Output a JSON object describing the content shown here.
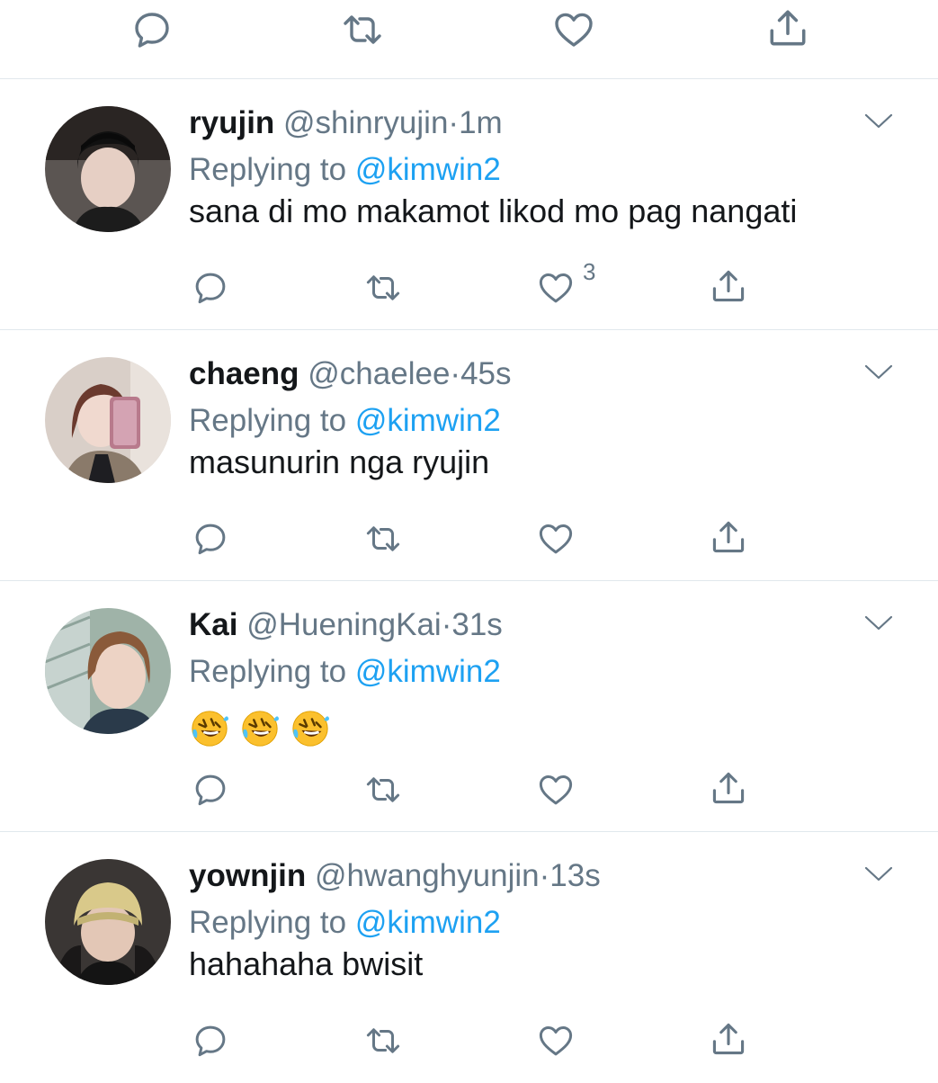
{
  "colors": {
    "text": "#14171a",
    "secondary": "#657786",
    "link": "#1da1f2",
    "divider": "#e1e8ed"
  },
  "top_actions": {
    "icons": [
      "reply-icon",
      "retweet-icon",
      "like-icon",
      "share-icon"
    ]
  },
  "replying_prefix": "Replying to",
  "tweets": [
    {
      "name": "ryujin",
      "handle": "@shinryujin",
      "separator": "·",
      "time": "1m",
      "reply_to": "@kimwin2",
      "text": "sana di mo makamot likod mo pag nangati",
      "like_count": "3"
    },
    {
      "name": "chaeng",
      "handle": "@chaelee",
      "separator": "·",
      "time": "45s",
      "reply_to": "@kimwin2",
      "text": "masunurin nga ryujin"
    },
    {
      "name": "Kai",
      "handle": "@HueningKai",
      "separator": "·",
      "time": "31s",
      "reply_to": "@kimwin2",
      "text": "🤣🤣🤣"
    },
    {
      "name": "yownjin",
      "handle": "@hwanghyunjin",
      "separator": "·",
      "time": "13s",
      "reply_to": "@kimwin2",
      "text": "hahahaha bwisit"
    }
  ]
}
